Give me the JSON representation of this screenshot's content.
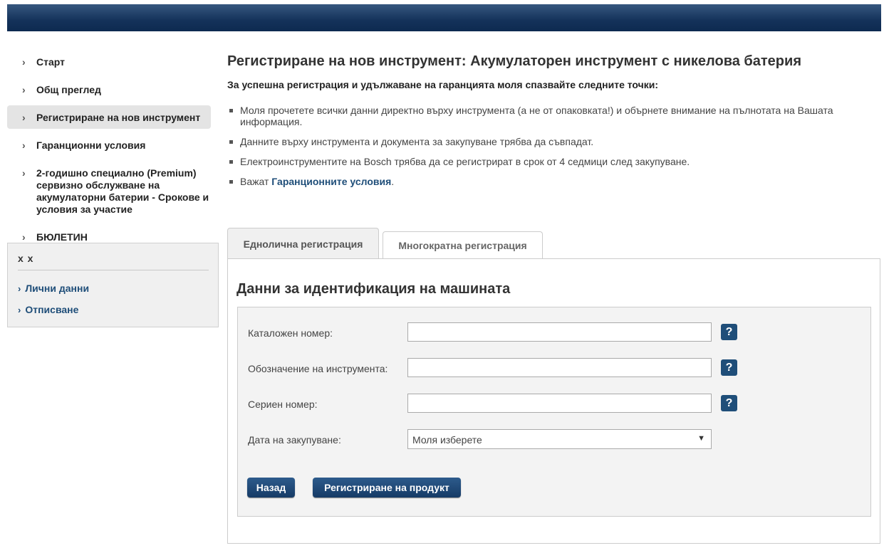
{
  "sidebar": {
    "items": [
      {
        "label": "Старт"
      },
      {
        "label": "Общ преглед"
      },
      {
        "label": "Регистриране на нов инструмент"
      },
      {
        "label": "Гаранционни условия"
      },
      {
        "label": "2-годишно специално (Premium) сервизно обслужване на акумулаторни батерии - Срокове и условия за участие"
      },
      {
        "label": "БЮЛЕТИН"
      }
    ],
    "box": {
      "title": "x x",
      "links": [
        {
          "label": "Лични данни"
        },
        {
          "label": "Отписване"
        }
      ]
    }
  },
  "main": {
    "title": "Регистриране на нов инструмент: Акумулаторен инструмент с никелова батерия",
    "intro": "За успешна регистрация и удължаване на гаранцията моля спазвайте следните точки:",
    "bullets": [
      "Моля прочетете всички данни директно върху инструмента (а не от опаковката!) и обърнете внимание на пълнотата на Вашата информация.",
      "Данните върху инструмента и документа за закупуване трябва да съвпадат.",
      "Електроинструментите на Bosch трябва да се регистрират в срок от 4 седмици след закупуване."
    ],
    "note_prefix": "Важат ",
    "note_link": "Гаранционните условия",
    "note_suffix": ".",
    "tabs": [
      {
        "label": "Еднолична регистрация"
      },
      {
        "label": "Многократна регистрация"
      }
    ],
    "panel_title": "Данни за идентификация на машината",
    "form": {
      "catalog_label": "Каталожен номер:",
      "catalog_value": "",
      "tool_label": "Обозначение на инструмента:",
      "tool_value": "",
      "serial_label": "Сериен номер:",
      "serial_value": "",
      "date_label": "Дата на закупуване:",
      "date_selected": "Моля изберете",
      "help": "?",
      "back_button": "Назад",
      "register_button": "Регистриране на продукт"
    }
  },
  "colors": {
    "accent": "#1f4e79",
    "header": "#14325a"
  }
}
